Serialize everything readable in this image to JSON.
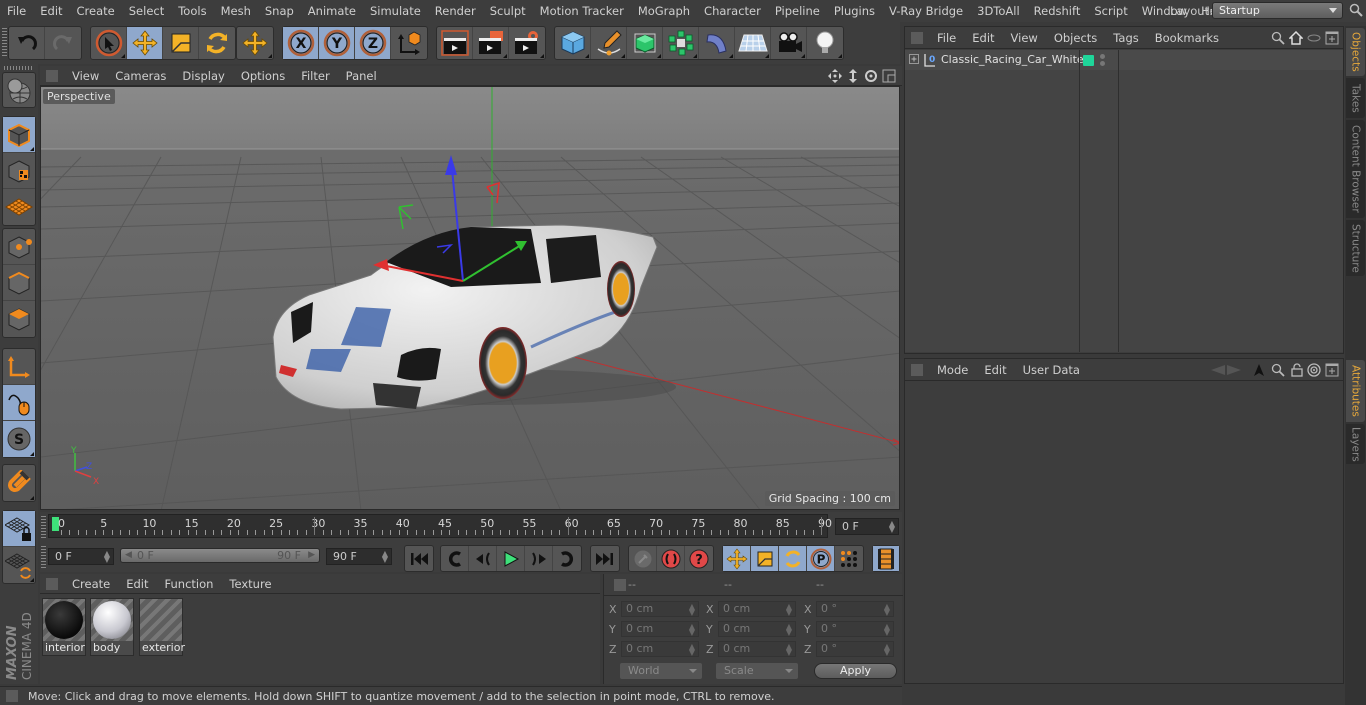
{
  "menubar": {
    "items": [
      "File",
      "Edit",
      "Create",
      "Select",
      "Tools",
      "Mesh",
      "Snap",
      "Animate",
      "Simulate",
      "Render",
      "Sculpt",
      "Motion Tracker",
      "MoGraph",
      "Character",
      "Pipeline",
      "Plugins",
      "V-Ray Bridge",
      "3DToAll",
      "Redshift",
      "Script",
      "Window",
      "Help"
    ],
    "layout_label": "Layout:",
    "layout_value": "Startup"
  },
  "toolbar": {
    "groups": [
      {
        "name": "history",
        "tools": [
          "undo",
          "redo"
        ]
      },
      {
        "name": "selection",
        "tools": [
          "live-selection",
          "move",
          "scale",
          "rotate"
        ]
      },
      {
        "name": "last-tool",
        "tools": [
          "last-used-move"
        ]
      },
      {
        "name": "axis-lock",
        "tools": [
          "x-axis",
          "y-axis",
          "z-axis",
          "coordinate-system"
        ]
      },
      {
        "name": "render",
        "tools": [
          "render-view",
          "render-to-picture-viewer",
          "render-settings"
        ]
      },
      {
        "name": "create",
        "tools": [
          "cube",
          "pen",
          "subdivision-surface",
          "cloner",
          "deformer",
          "floor",
          "camera",
          "light"
        ]
      }
    ],
    "active_tools": [
      "move",
      "x-axis",
      "y-axis",
      "z-axis"
    ]
  },
  "left_toolbar": {
    "modes": [
      "model",
      "texture",
      "workplane",
      "points",
      "edges",
      "polygons",
      "axis",
      "tweak",
      "solo",
      "snap",
      "workplane-lock",
      "locked-workplane"
    ],
    "active_modes": [
      "model",
      "tweak",
      "solo",
      "workplane-lock"
    ]
  },
  "viewport": {
    "menu": [
      "View",
      "Cameras",
      "Display",
      "Options",
      "Filter",
      "Panel"
    ],
    "camera_label": "Perspective",
    "grid_spacing": "Grid Spacing : 100 cm",
    "axis_labels": {
      "x": "X",
      "y": "Y",
      "z": "Z"
    }
  },
  "timeline": {
    "ticks": [
      "0",
      "5",
      "10",
      "15",
      "20",
      "25",
      "30",
      "35",
      "40",
      "45",
      "50",
      "55",
      "60",
      "65",
      "70",
      "75",
      "80",
      "85",
      "90"
    ],
    "current_frame": "0 F",
    "start_frame": "0 F",
    "range_start": "0 F",
    "range_end": "90 F",
    "end_frame": "90 F"
  },
  "transport": {
    "buttons": [
      "go-to-start",
      "go-to-previous-key",
      "play-backwards",
      "play-forwards",
      "go-to-next-key",
      "go-to-end",
      "record-keys",
      "auto-keying",
      "keyframe-selection",
      "record-position",
      "record-scale",
      "record-rotation",
      "record-parameter",
      "record-point-level",
      "scheme-settings"
    ]
  },
  "materials": {
    "menu": [
      "Create",
      "Edit",
      "Function",
      "Texture"
    ],
    "items": [
      {
        "name": "interior",
        "color": "#111111"
      },
      {
        "name": "body",
        "color": "#e0e0e6"
      },
      {
        "name": "exterior",
        "color": null
      }
    ]
  },
  "coordinates": {
    "headers": [
      "--",
      "--",
      "--"
    ],
    "rows": [
      {
        "axis": "X",
        "position": "0 cm",
        "size": "0 cm",
        "rotation": "0 °"
      },
      {
        "axis": "Y",
        "position": "0 cm",
        "size": "0 cm",
        "rotation": "0 °"
      },
      {
        "axis": "Z",
        "position": "0 cm",
        "size": "0 cm",
        "rotation": "0 °"
      }
    ],
    "space_select": "World",
    "mode_select": "Scale",
    "apply_label": "Apply"
  },
  "objects_panel": {
    "menu": [
      "File",
      "Edit",
      "View",
      "Objects",
      "Tags",
      "Bookmarks"
    ],
    "objects": [
      {
        "name": "Classic_Racing_Car_White",
        "layer_color": "#1fd69a"
      }
    ]
  },
  "attributes_panel": {
    "menu": [
      "Mode",
      "Edit",
      "User Data"
    ]
  },
  "right_tabs": {
    "top": [
      {
        "label": "Objects",
        "active": true
      },
      {
        "label": "Takes",
        "active": false
      },
      {
        "label": "Content Browser",
        "active": false
      },
      {
        "label": "Structure",
        "active": false
      }
    ],
    "bottom": [
      {
        "label": "Attributes",
        "active": true
      },
      {
        "label": "Layers",
        "active": false
      }
    ]
  },
  "branding": {
    "maxon": "MAXON",
    "product": "CINEMA 4D"
  },
  "status": {
    "text": "Move: Click and drag to move elements. Hold down SHIFT to quantize movement / add to the selection in point mode, CTRL to remove."
  },
  "colors": {
    "accent_tab": "#e8a93a",
    "active_tool": "#8fa8cc",
    "layer_green": "#1fd69a",
    "axis_x": "#e03a3a",
    "axis_y": "#3ac83a",
    "axis_z": "#3a4ae0"
  }
}
